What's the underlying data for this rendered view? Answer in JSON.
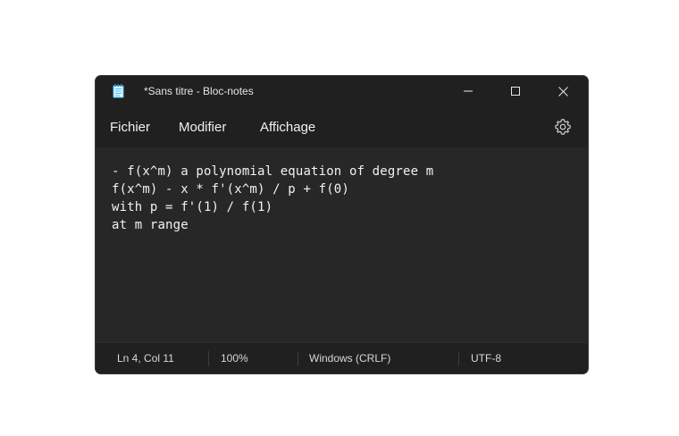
{
  "window": {
    "title": "*Sans titre - Bloc-notes"
  },
  "menu": {
    "items": [
      {
        "label": "Fichier"
      },
      {
        "label": "Modifier"
      },
      {
        "label": "Affichage"
      }
    ],
    "settings_icon": "gear-icon"
  },
  "editor": {
    "lines": [
      "- f(x^m) a polynomial equation of degree m",
      "f(x^m) - x * f'(x^m) / p + f(0)",
      "with p = f'(1) / f(1)",
      "at m range"
    ]
  },
  "status": {
    "position": "Ln 4, Col 11",
    "zoom": "100%",
    "line_ending": "Windows (CRLF)",
    "encoding": "UTF-8"
  },
  "colors": {
    "background": "#202020",
    "editor_background": "#272727",
    "text": "#f2f2f2",
    "app_icon_accent": "#4fc3f7"
  }
}
